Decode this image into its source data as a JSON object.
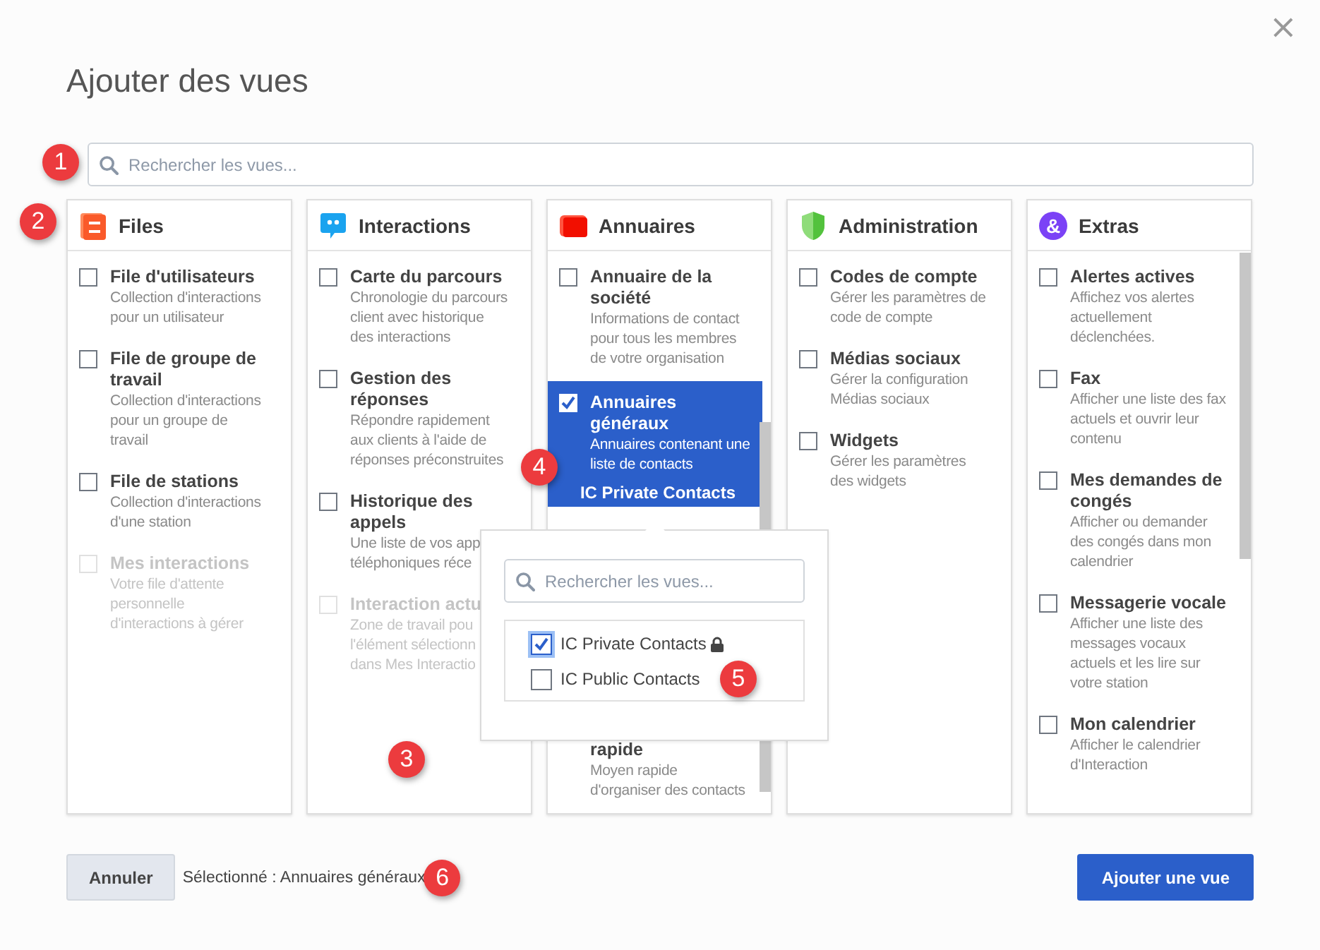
{
  "dialog": {
    "title": "Ajouter des vues",
    "close": "×"
  },
  "search": {
    "placeholder": "Rechercher les vues...",
    "callout": "1"
  },
  "columns": [
    {
      "title": "Files",
      "kind": "document",
      "callout": "2",
      "items": [
        {
          "kind": "view",
          "title": "File d'utilisateurs",
          "description": "Collection d'interactions pour un utilisateur",
          "checked": false,
          "disabled": false,
          "selected": false
        },
        {
          "kind": "view",
          "title": "File de groupe de travail",
          "description": "Collection d'interactions pour un groupe de travail",
          "checked": false,
          "disabled": false,
          "selected": false
        },
        {
          "kind": "view",
          "title": "File de stations",
          "description": "Collection d'interactions d'une station",
          "checked": false,
          "disabled": false,
          "selected": false
        },
        {
          "kind": "view",
          "title": "Mes interactions",
          "description": "Votre file d'attente personnelle d'interactions à gérer",
          "checked": false,
          "disabled": true,
          "selected": false
        }
      ]
    },
    {
      "title": "Interactions",
      "kind": "chat",
      "callout": "3",
      "items": [
        {
          "kind": "view",
          "title": "Carte du parcours",
          "description": "Chronologie du parcours client avec historique des interactions",
          "checked": false,
          "disabled": false,
          "selected": false
        },
        {
          "kind": "view",
          "title": "Gestion des réponses",
          "description": "Répondre rapidement aux clients à l'aide de réponses préconstruites",
          "checked": false,
          "disabled": false,
          "selected": false
        },
        {
          "kind": "view",
          "title": "Historique des appels",
          "description": "Une liste de vos app\ntéléphoniques réce",
          "checked": false,
          "disabled": false,
          "selected": false
        },
        {
          "kind": "view",
          "title": "Interaction actu",
          "description": "Zone de travail pou\nl'élément sélectionn\ndans Mes Interactio",
          "checked": false,
          "disabled": true,
          "selected": false
        }
      ]
    },
    {
      "title": "Annuaires",
      "kind": "book",
      "scrollbar": true,
      "items": [
        {
          "kind": "view",
          "title": "Annuaire de la société",
          "description": "Informations de contact pour tous les membres de votre organisation",
          "checked": false,
          "disabled": false,
          "selected": false
        },
        {
          "kind": "view",
          "title": "Annuaires généraux",
          "description": "Annuaires contenant une liste de contacts",
          "sub_label": "IC Private Contacts",
          "callout": "4",
          "checked": true,
          "disabled": false,
          "selected": true
        },
        {
          "kind": "continued",
          "title": "rapide",
          "description": "Moyen rapide d'organiser des contacts"
        }
      ]
    },
    {
      "title": "Administration",
      "kind": "shield",
      "items": [
        {
          "kind": "view",
          "title": "Codes de compte",
          "description": "Gérer les paramètres de code de compte",
          "checked": false,
          "disabled": false,
          "selected": false
        },
        {
          "kind": "view",
          "title": "Médias sociaux",
          "description": "Gérer la configuration Médias sociaux",
          "checked": false,
          "disabled": false,
          "selected": false
        },
        {
          "kind": "view",
          "title": "Widgets",
          "description": "Gérer les paramètres des widgets",
          "checked": false,
          "disabled": false,
          "selected": false
        }
      ]
    },
    {
      "title": "Extras",
      "kind": "badge",
      "icon_text": "&",
      "scrollbar": true,
      "items": [
        {
          "kind": "view",
          "title": "Alertes actives",
          "description": "Affichez vos alertes actuellement déclenchées.",
          "checked": false,
          "disabled": false,
          "selected": false
        },
        {
          "kind": "view",
          "title": "Fax",
          "description": "Afficher une liste des fax actuels et ouvrir leur contenu",
          "checked": false,
          "disabled": false,
          "selected": false
        },
        {
          "kind": "view",
          "title": "Mes demandes de congés",
          "description": "Afficher ou demander des congés dans mon calendrier",
          "checked": false,
          "disabled": false,
          "selected": false
        },
        {
          "kind": "view",
          "title": "Messagerie vocale",
          "description": "Afficher une liste des messages vocaux actuels et les lire sur votre station",
          "checked": false,
          "disabled": false,
          "selected": false
        },
        {
          "kind": "view",
          "title": "Mon calendrier",
          "description": "Afficher le calendrier d'Interaction",
          "checked": false,
          "disabled": false,
          "selected": false
        }
      ]
    }
  ],
  "popover": {
    "placeholder": "Rechercher les vues...",
    "callout": "5",
    "options": [
      {
        "label": "IC Private Contacts",
        "checked": true,
        "locked": true
      },
      {
        "label": "IC Public Contacts",
        "checked": false,
        "locked": false
      }
    ]
  },
  "footer": {
    "cancel": "Annuler",
    "status": "Sélectionné : Annuaires généraux",
    "callout": "6",
    "submit": "Ajouter une vue"
  }
}
